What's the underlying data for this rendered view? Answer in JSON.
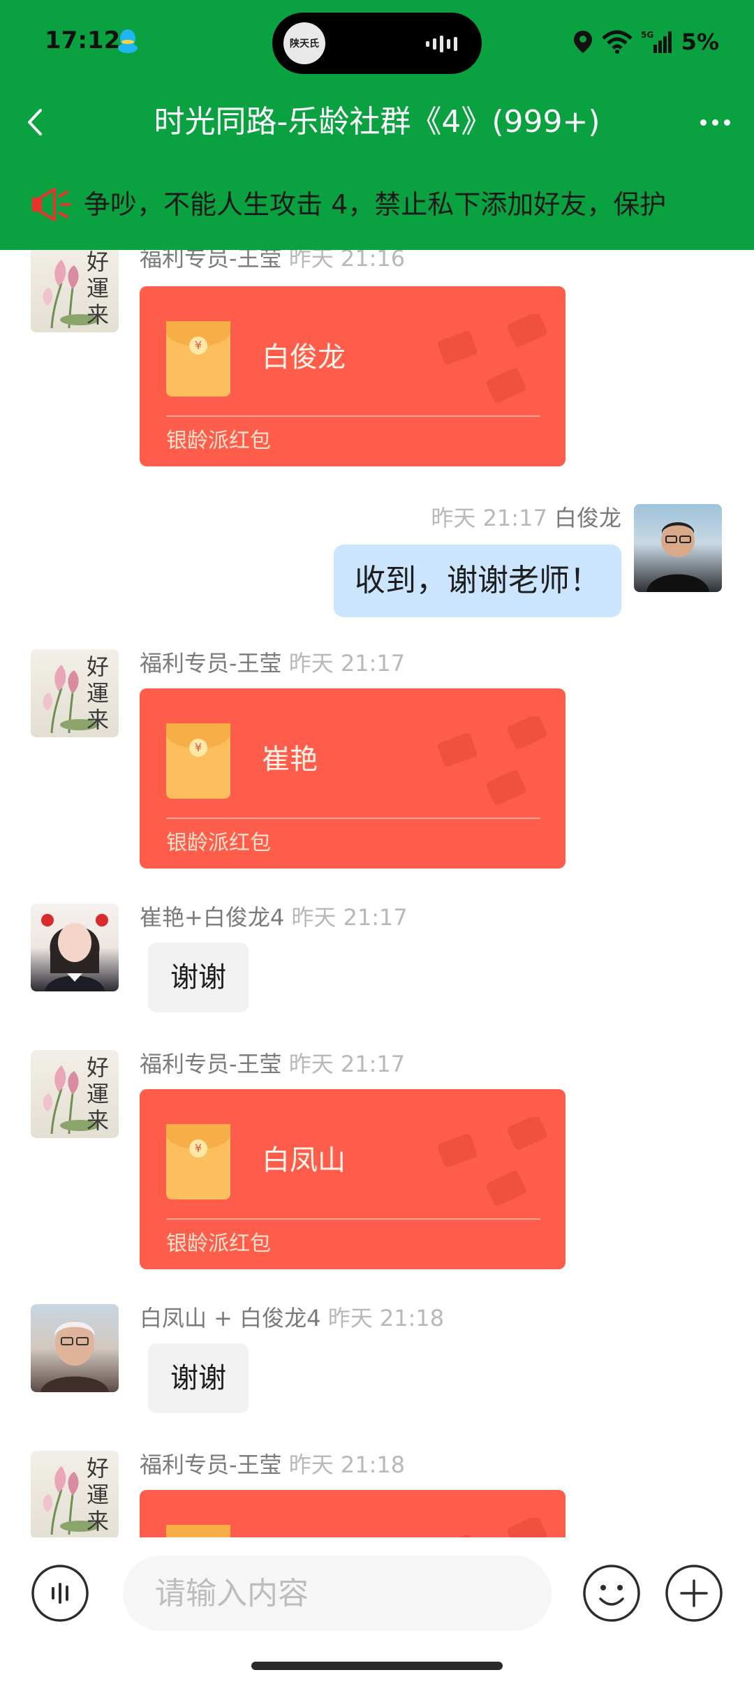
{
  "status_bar": {
    "time": "17:12",
    "island_logo_text": "陕天氏",
    "battery": "5%",
    "network": "5G"
  },
  "header": {
    "title": "时光同路-乐龄社群《4》(999+)"
  },
  "announcement": {
    "text": "争吵，不能人生攻击 4，禁止私下添加好友，保护"
  },
  "messages": [
    {
      "type": "redpacket",
      "side": "left",
      "avatar": "lotus-avatar",
      "sender": "福利专员-王莹",
      "time": "昨天 21:16",
      "recipient": "白俊龙",
      "footer": "银龄派红包"
    },
    {
      "type": "text",
      "side": "right",
      "avatar": "man-glasses-avatar",
      "sender": "白俊龙",
      "time": "昨天 21:17",
      "text": "收到，谢谢老师！"
    },
    {
      "type": "redpacket",
      "side": "left",
      "avatar": "lotus-avatar",
      "sender": "福利专员-王莹",
      "time": "昨天 21:17",
      "recipient": "崔艳",
      "footer": "银龄派红包"
    },
    {
      "type": "text",
      "side": "left",
      "avatar": "woman-avatar",
      "sender": "崔艳+白俊龙4",
      "time": "昨天 21:17",
      "text": "谢谢"
    },
    {
      "type": "redpacket",
      "side": "left",
      "avatar": "lotus-avatar",
      "sender": "福利专员-王莹",
      "time": "昨天 21:17",
      "recipient": "白凤山",
      "footer": "银龄派红包"
    },
    {
      "type": "text",
      "side": "left",
      "avatar": "man-avatar",
      "sender": "白凤山 + 白俊龙4",
      "time": "昨天 21:18",
      "text": "谢谢"
    },
    {
      "type": "redpacket",
      "side": "left",
      "avatar": "lotus-avatar",
      "sender": "福利专员-王莹",
      "time": "昨天 21:18",
      "recipient": "",
      "footer": ""
    }
  ],
  "lotus_calligraphy": "好運来",
  "input": {
    "placeholder": "请输入内容"
  },
  "colors": {
    "header_green": "#0aa240",
    "redpacket": "#ff5d4b",
    "own_bubble": "#cce5ff",
    "other_bubble": "#f1f1f1"
  },
  "icons": [
    "back-arrow-icon",
    "more-icon",
    "speaker-icon",
    "voice-icon",
    "emoji-icon",
    "plus-icon",
    "qq-icon",
    "location-icon",
    "wifi-icon",
    "signal-icon"
  ]
}
